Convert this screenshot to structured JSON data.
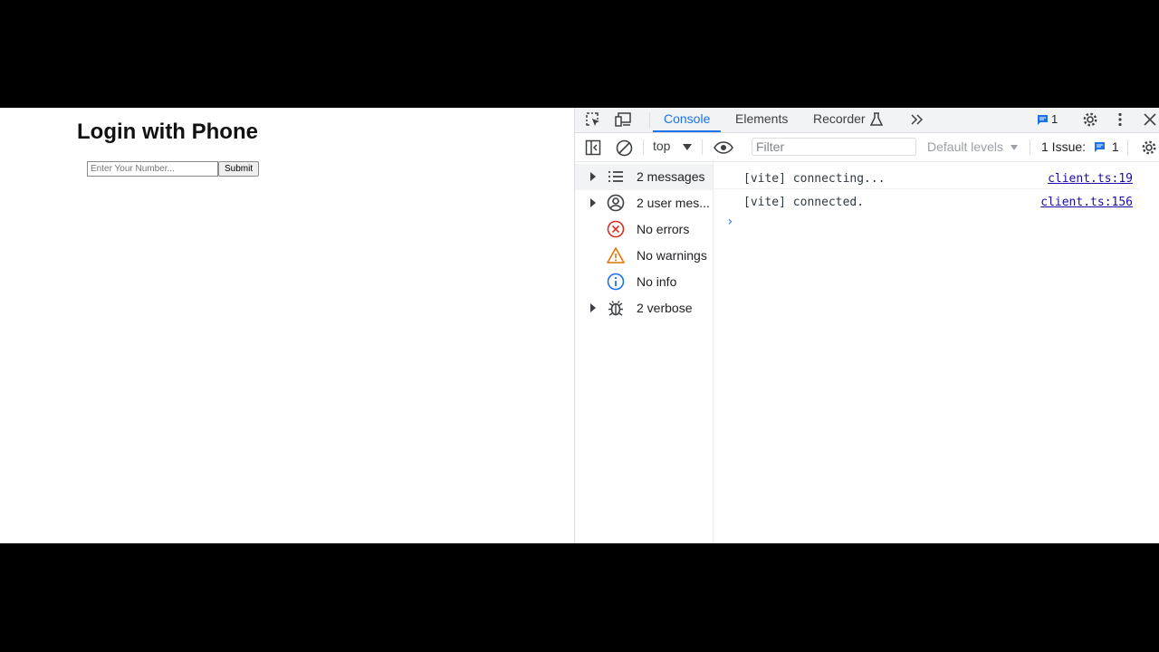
{
  "page": {
    "title": "Login with Phone",
    "phone_placeholder": "Enter Your Number...",
    "submit_label": "Submit"
  },
  "devtools": {
    "tabs": {
      "console": "Console",
      "elements": "Elements",
      "recorder": "Recorder"
    },
    "message_badge_count": "1",
    "toolbar": {
      "context": "top",
      "filter_placeholder": "Filter",
      "levels": "Default levels",
      "issues_label": "1 Issue:",
      "issues_count": "1"
    },
    "sidebar": [
      {
        "label": "2 messages",
        "icon": "list-icon"
      },
      {
        "label": "2 user mes...",
        "icon": "user-icon"
      },
      {
        "label": "No errors",
        "icon": "error-icon"
      },
      {
        "label": "No warnings",
        "icon": "warning-icon"
      },
      {
        "label": "No info",
        "icon": "info-icon"
      },
      {
        "label": "2 verbose",
        "icon": "bug-icon"
      }
    ],
    "messages": [
      {
        "text": "[vite] connecting...",
        "source": "client.ts:19"
      },
      {
        "text": "[vite] connected.",
        "source": "client.ts:156"
      }
    ],
    "colors": {
      "accent": "#1a73e8",
      "error": "#d93025",
      "warning": "#e37400"
    }
  }
}
